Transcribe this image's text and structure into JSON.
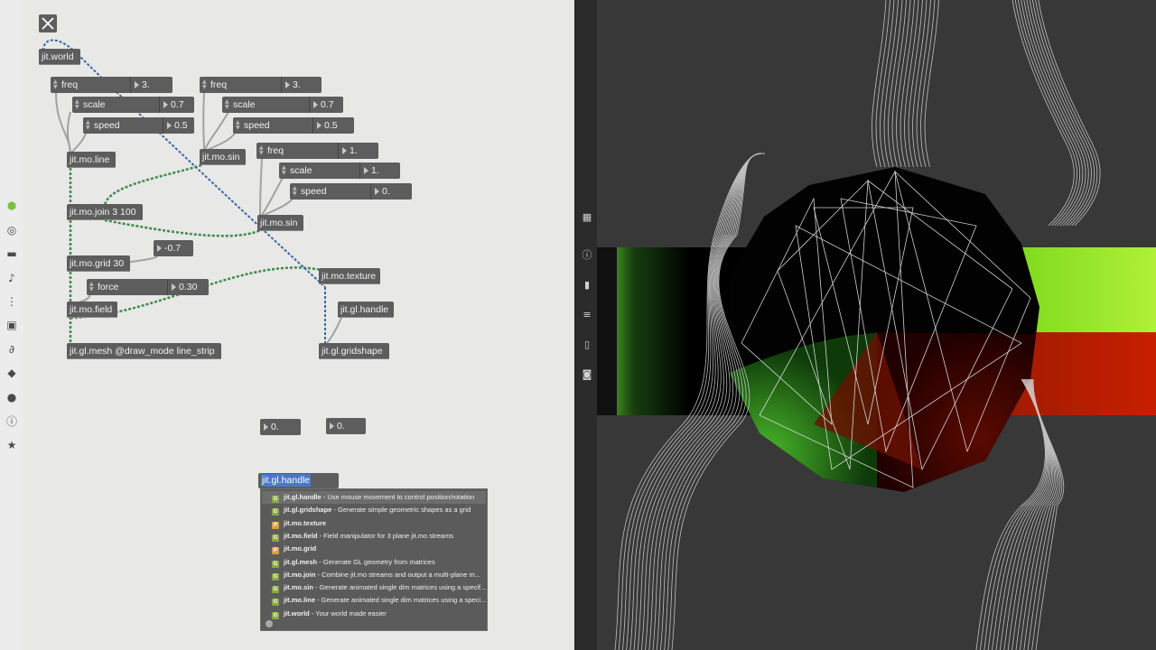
{
  "left_toolbar": {
    "icons": [
      "cube-icon",
      "target-icon",
      "film-icon",
      "note-icon",
      "step-icon",
      "image-icon",
      "paperclip-icon",
      "plug-icon",
      "pin-icon",
      "info-icon",
      "star-icon"
    ]
  },
  "patcher": {
    "objects": {
      "jit_world": "jit.world",
      "mo_line": "jit.mo.line",
      "mo_sin_1": "jit.mo.sin",
      "mo_sin_2": "jit.mo.sin",
      "mo_join": "jit.mo.join 3 100",
      "mo_grid": "jit.mo.grid 30",
      "mo_field": "jit.mo.field",
      "gl_mesh": "jit.gl.mesh @draw_mode line_strip",
      "mo_texture": "jit.mo.texture",
      "gl_handle": "jit.gl.handle",
      "gl_gridshape": "jit.gl.gridshape"
    },
    "attrs": {
      "g1_freq": {
        "name": "freq",
        "value": "3."
      },
      "g1_scale": {
        "name": "scale",
        "value": "0.7"
      },
      "g1_speed": {
        "name": "speed",
        "value": "0.5"
      },
      "g2_freq": {
        "name": "freq",
        "value": "3."
      },
      "g2_scale": {
        "name": "scale",
        "value": "0.7"
      },
      "g2_speed": {
        "name": "speed",
        "value": "0.5"
      },
      "g3_freq": {
        "name": "freq",
        "value": "1."
      },
      "g3_scale": {
        "name": "scale",
        "value": "1."
      },
      "g3_speed": {
        "name": "speed",
        "value": "0."
      },
      "force": {
        "name": "force",
        "value": "0.30"
      }
    },
    "numbers": {
      "grid_num": "-0.7",
      "num_a": "0.",
      "num_b": "0."
    },
    "new_object": {
      "text": "jit.gl.handle"
    },
    "autocomplete": {
      "items": [
        {
          "badge": "G",
          "name": "jit.gl.handle",
          "desc": " - Use mouse movement to control position/rotation"
        },
        {
          "badge": "G",
          "name": "jit.gl.gridshape",
          "desc": " - Generate simple geometric shapes as a grid"
        },
        {
          "badge": "P",
          "name": "jit.mo.texture",
          "desc": ""
        },
        {
          "badge": "G",
          "name": "jit.mo.field",
          "desc": " - Field manipulator for 3 plane jit.mo streams"
        },
        {
          "badge": "P",
          "name": "jit.mo.grid",
          "desc": ""
        },
        {
          "badge": "G",
          "name": "jit.gl.mesh",
          "desc": " - Generate GL geometry from matrices"
        },
        {
          "badge": "G",
          "name": "jit.mo.join",
          "desc": " - Combine jit.mo streams and output a multi-plane m..."
        },
        {
          "badge": "G",
          "name": "jit.mo.sin",
          "desc": " - Generate animated single dim matrices using a specif..."
        },
        {
          "badge": "G",
          "name": "jit.mo.line",
          "desc": " - Generate animated single dim matrices using a speci..."
        },
        {
          "badge": "G",
          "name": "jit.world",
          "desc": " - Your world made easier"
        }
      ]
    }
  },
  "mid_toolbar": {
    "icons": [
      "grid-icon",
      "info-icon",
      "book-icon",
      "list-icon",
      "book-open-icon",
      "camera-icon"
    ]
  },
  "colors": {
    "patch_cord": "#9a9a9a",
    "matrix_cord": "#3e8a4a",
    "gl_cord": "#3a66a8",
    "viewer_bg": "#383838"
  }
}
